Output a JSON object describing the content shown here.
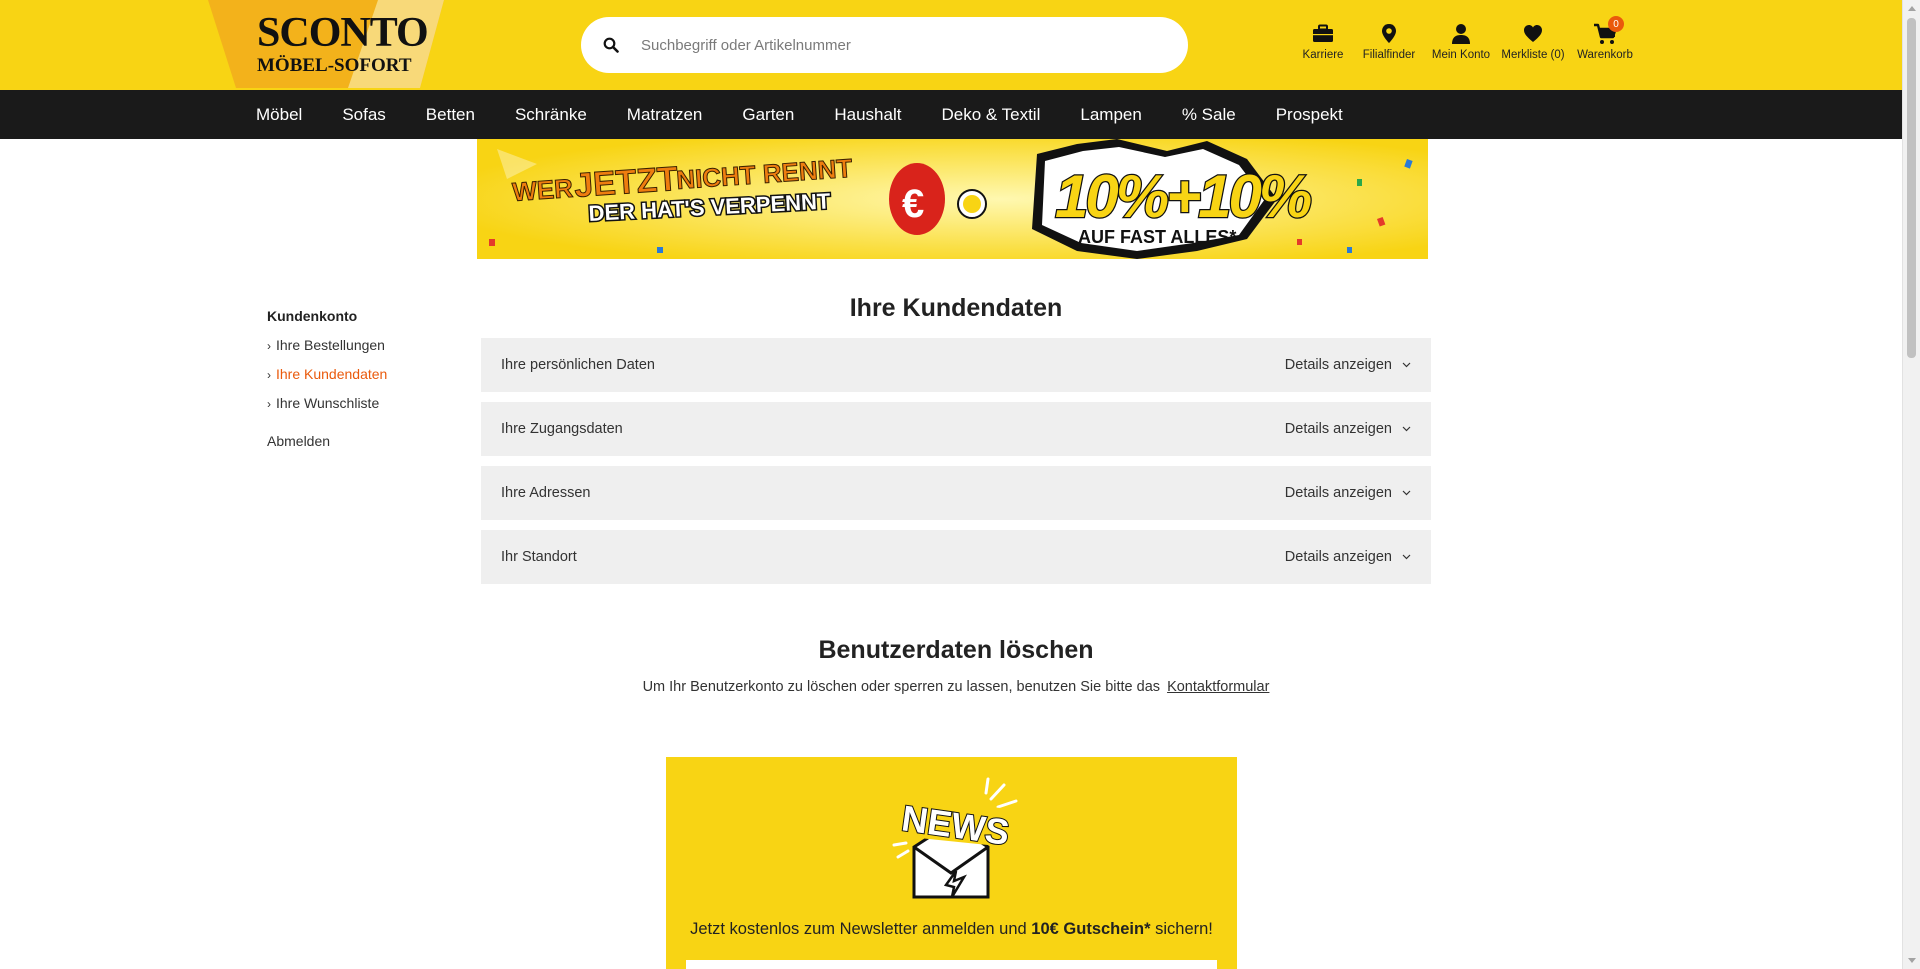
{
  "header": {
    "logo_line1": "SCONTO",
    "logo_line2": "MÖBEL-SOFORT",
    "search_placeholder": "Suchbegriff oder Artikelnummer",
    "icons": {
      "karriere": "Karriere",
      "filialfinder": "Filialfinder",
      "mein_konto": "Mein Konto",
      "merkliste": "Merkliste (0)",
      "warenkorb": "Warenkorb",
      "cart_count": "0"
    }
  },
  "nav": [
    "Möbel",
    "Sofas",
    "Betten",
    "Schränke",
    "Matratzen",
    "Garten",
    "Haushalt",
    "Deko & Textil",
    "Lampen",
    "% Sale",
    "Prospekt"
  ],
  "promo": {
    "line1a": "WER",
    "line1b": "JETZT",
    "line1c": "NICHT RENNT",
    "line2": "DER HAT'S VERPENNT",
    "offer": "10%+10%",
    "offer_sub": "AUF FAST ALLES*"
  },
  "sidebar": {
    "title": "Kundenkonto",
    "items": [
      "Ihre Bestellungen",
      "Ihre Kundendaten",
      "Ihre Wunschliste"
    ],
    "logout": "Abmelden"
  },
  "main": {
    "title": "Ihre Kundendaten",
    "details_label": "Details anzeigen",
    "sections": [
      "Ihre persönlichen Daten",
      "Ihre Zugangsdaten",
      "Ihre Adressen",
      "Ihr Standort"
    ]
  },
  "delete": {
    "title": "Benutzerdaten löschen",
    "text": "Um Ihr Benutzerkonto zu löschen oder sperren zu lassen, benutzen Sie bitte das",
    "link": "Kontaktformular"
  },
  "newsletter": {
    "badge": "NEWS",
    "text_pre": "Jetzt kostenlos zum Newsletter anmelden und ",
    "text_bold": "10€ Gutschein*",
    "text_post": " sichern!"
  },
  "colors": {
    "brand_yellow": "#f8d414",
    "nav_black": "#1a1a1a",
    "accent_orange": "#ea5a0c"
  }
}
